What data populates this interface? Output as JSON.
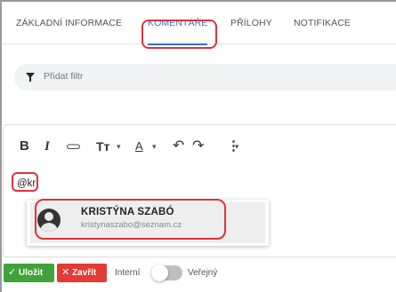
{
  "tabs": [
    {
      "label": "ZÁKLADNÍ INFORMACE",
      "active": false
    },
    {
      "label": "KOMENTÁŘE",
      "active": true
    },
    {
      "label": "PŘÍLOHY",
      "active": false
    },
    {
      "label": "NOTIFIKACE",
      "active": false
    }
  ],
  "filter": {
    "icon": "filter-icon",
    "label": "Přidat filtr"
  },
  "toolbar": {
    "bold": "B",
    "italic": "I",
    "link": "⊂⊃",
    "text_size": "Tт",
    "font_color": "A",
    "undo": "↶",
    "redo": "↷",
    "more": "⋮",
    "caret": "▾"
  },
  "editor": {
    "content": "@kr"
  },
  "mention_dropdown": {
    "items": [
      {
        "name": "KRISTÝNA SZABÓ",
        "email": "kristynaszabo@seznam.cz",
        "avatar": "user-avatar-icon"
      }
    ]
  },
  "actions": {
    "save_label": "Uložit",
    "save_icon": "✓",
    "close_label": "Zavřít",
    "close_icon": "✕"
  },
  "visibility": {
    "internal_label": "Interní",
    "public_label": "Veřejný",
    "state": "internal"
  },
  "colors": {
    "accent": "#3b6fc8",
    "save": "#3fa33a",
    "close": "#e33b35",
    "annotation": "#e0313c"
  }
}
